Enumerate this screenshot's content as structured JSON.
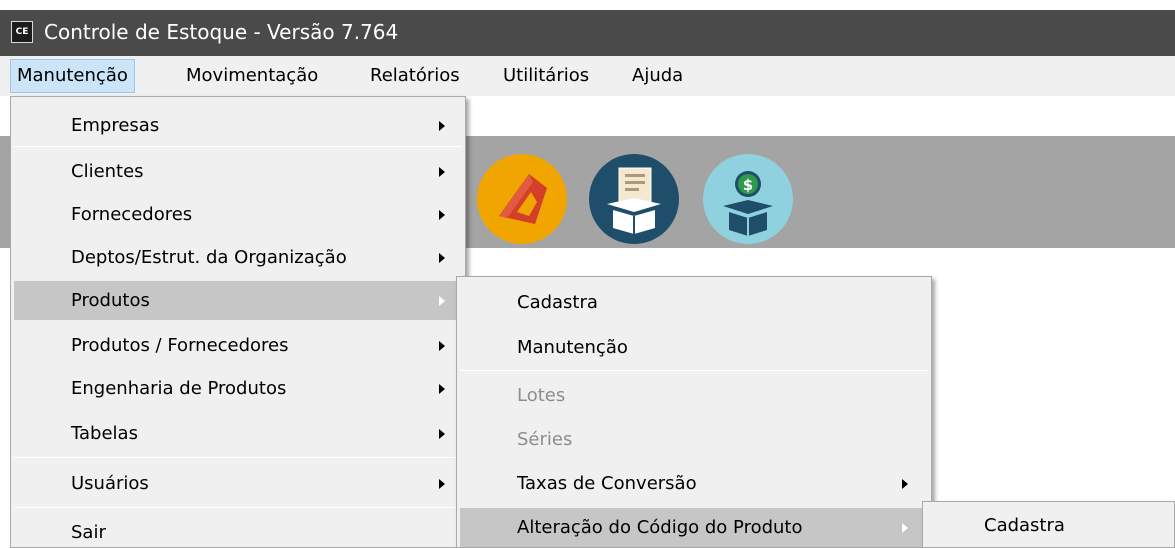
{
  "window": {
    "icon_text": "CE",
    "title": "Controle de Estoque - Versão 7.764"
  },
  "menubar": {
    "items": [
      {
        "label": "Manutenção"
      },
      {
        "label": "Movimentação"
      },
      {
        "label": "Relatórios"
      },
      {
        "label": "Utilitários"
      },
      {
        "label": "Ajuda"
      }
    ]
  },
  "toolbar": {
    "icons": [
      {
        "name": "red-cube-icon",
        "color": "#f0a500"
      },
      {
        "name": "document-box-icon",
        "color": "#1f4e6b"
      },
      {
        "name": "money-box-icon",
        "color": "#8fd1df"
      }
    ]
  },
  "menu_manutencao": {
    "items": [
      {
        "label": "Empresas",
        "has_submenu": true
      },
      {
        "label": "Clientes",
        "has_submenu": true
      },
      {
        "label": "Fornecedores",
        "has_submenu": true
      },
      {
        "label": "Deptos/Estrut. da Organização",
        "has_submenu": true
      },
      {
        "label": "Produtos",
        "has_submenu": true,
        "highlighted": true
      },
      {
        "label": "Produtos / Fornecedores",
        "has_submenu": true
      },
      {
        "label": "Engenharia de Produtos",
        "has_submenu": true
      },
      {
        "label": "Tabelas",
        "has_submenu": true
      },
      {
        "label": "Usuários",
        "has_submenu": true
      },
      {
        "label": "Sair",
        "has_submenu": false
      }
    ]
  },
  "menu_produtos": {
    "items": [
      {
        "label": "Cadastra",
        "enabled": true
      },
      {
        "label": "Manutenção",
        "enabled": true
      },
      {
        "label": "Lotes",
        "enabled": false
      },
      {
        "label": "Séries",
        "enabled": false
      },
      {
        "label": "Taxas de Conversão",
        "enabled": true,
        "has_submenu": true
      },
      {
        "label": "Alteração do Código do Produto",
        "enabled": true,
        "has_submenu": true,
        "highlighted": true
      }
    ]
  },
  "menu_alteracao": {
    "items": [
      {
        "label": "Cadastra"
      }
    ]
  },
  "colors": {
    "titlebar": "#4a4a4a",
    "menu_bg": "#f0f0f0",
    "menu_highlight": "#c6c6c6",
    "toolbar_bg": "#a4a4a4"
  }
}
